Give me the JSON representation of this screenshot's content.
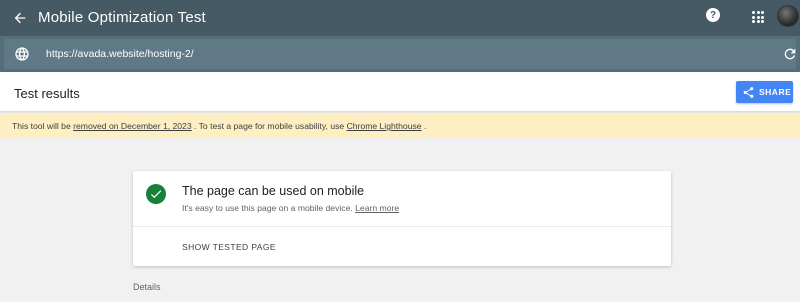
{
  "app": {
    "title": "Mobile Optimization Test",
    "help_glyph": "?"
  },
  "urlbar": {
    "url": "https://avada.website/hosting-2/"
  },
  "results": {
    "heading": "Test results",
    "share_label": "SHARE"
  },
  "notice": {
    "prefix": "This tool will be",
    "removed_link": "removed on December 1, 2023",
    "middle": ". To test a page for mobile usability, use",
    "lighthouse_link": "Chrome Lighthouse",
    "suffix": "."
  },
  "status_card": {
    "title": "The page can be used on mobile",
    "subtitle": "It's easy to use this page on a mobile device.",
    "learn_more": "Learn more",
    "tested_page_label": "SHOW TESTED PAGE"
  },
  "details": {
    "label": "Details"
  },
  "colors": {
    "header": "#455a64",
    "urlbar": "#546e7a",
    "accent": "#4285f4",
    "success": "#188038",
    "notice_bg": "#feefc3"
  },
  "icons": {
    "back": "arrow-back-icon",
    "help": "help-icon",
    "apps": "apps-grid-icon",
    "globe": "globe-icon",
    "reload": "reload-icon",
    "share": "share-icon",
    "check": "check-circle-icon"
  }
}
